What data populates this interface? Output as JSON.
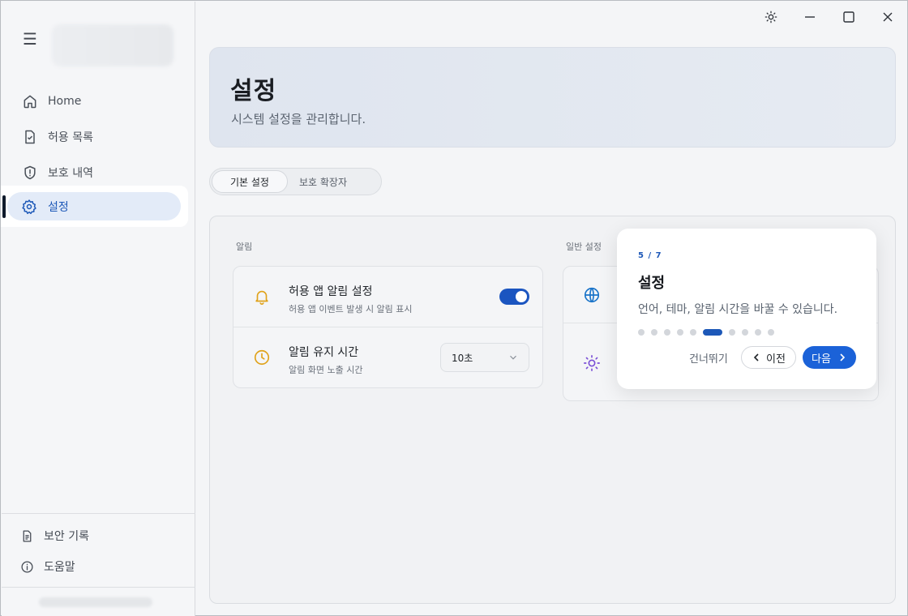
{
  "sidebar": {
    "menu_icon": "hamburger-icon",
    "items": [
      {
        "label": "Home",
        "icon": "home-icon"
      },
      {
        "label": "허용 목록",
        "icon": "file-check-icon"
      },
      {
        "label": "보호 내역",
        "icon": "shield-alert-icon"
      },
      {
        "label": "설정",
        "icon": "gear-icon"
      }
    ],
    "bottom": [
      {
        "label": "보안 기록",
        "icon": "document-icon"
      },
      {
        "label": "도움말",
        "icon": "info-icon"
      }
    ]
  },
  "titlebar": {
    "buttons": [
      "theme-sun-icon",
      "minimize-icon",
      "maximize-icon",
      "close-icon"
    ]
  },
  "header": {
    "title": "설정",
    "subtitle": "시스템 설정을 관리합니다."
  },
  "tabs": [
    {
      "label": "기본 설정",
      "active": true
    },
    {
      "label": "보호 확장자",
      "active": false
    }
  ],
  "panel": {
    "notifications": {
      "label": "알림",
      "rows": [
        {
          "title": "허용 앱 알림 설정",
          "subtitle": "허용 앱 이벤트 발생 시 알림 표시",
          "icon": "bell-icon",
          "control": "toggle",
          "enabled": true
        },
        {
          "title": "알림 유지 시간",
          "subtitle": "알림 화면 노출 시간",
          "icon": "clock-icon",
          "control": "select",
          "value": "10초"
        }
      ]
    },
    "general": {
      "label": "일반 설정",
      "icons": [
        "globe-icon",
        "sun-icon"
      ]
    }
  },
  "tour": {
    "step": "5 / 7",
    "title": "설정",
    "description": "언어, 테마, 알림 시간을 바꿀 수 있습니다.",
    "total_dots": 10,
    "active_dot": 5,
    "skip_label": "건너뛰기",
    "prev_label": "이전",
    "next_label": "다음"
  },
  "colors": {
    "accent": "#1b62d8",
    "toggle_on": "#1b55c0",
    "bell": "#e0a21a",
    "globe": "#1a74c9",
    "sun": "#7a4fd6"
  }
}
